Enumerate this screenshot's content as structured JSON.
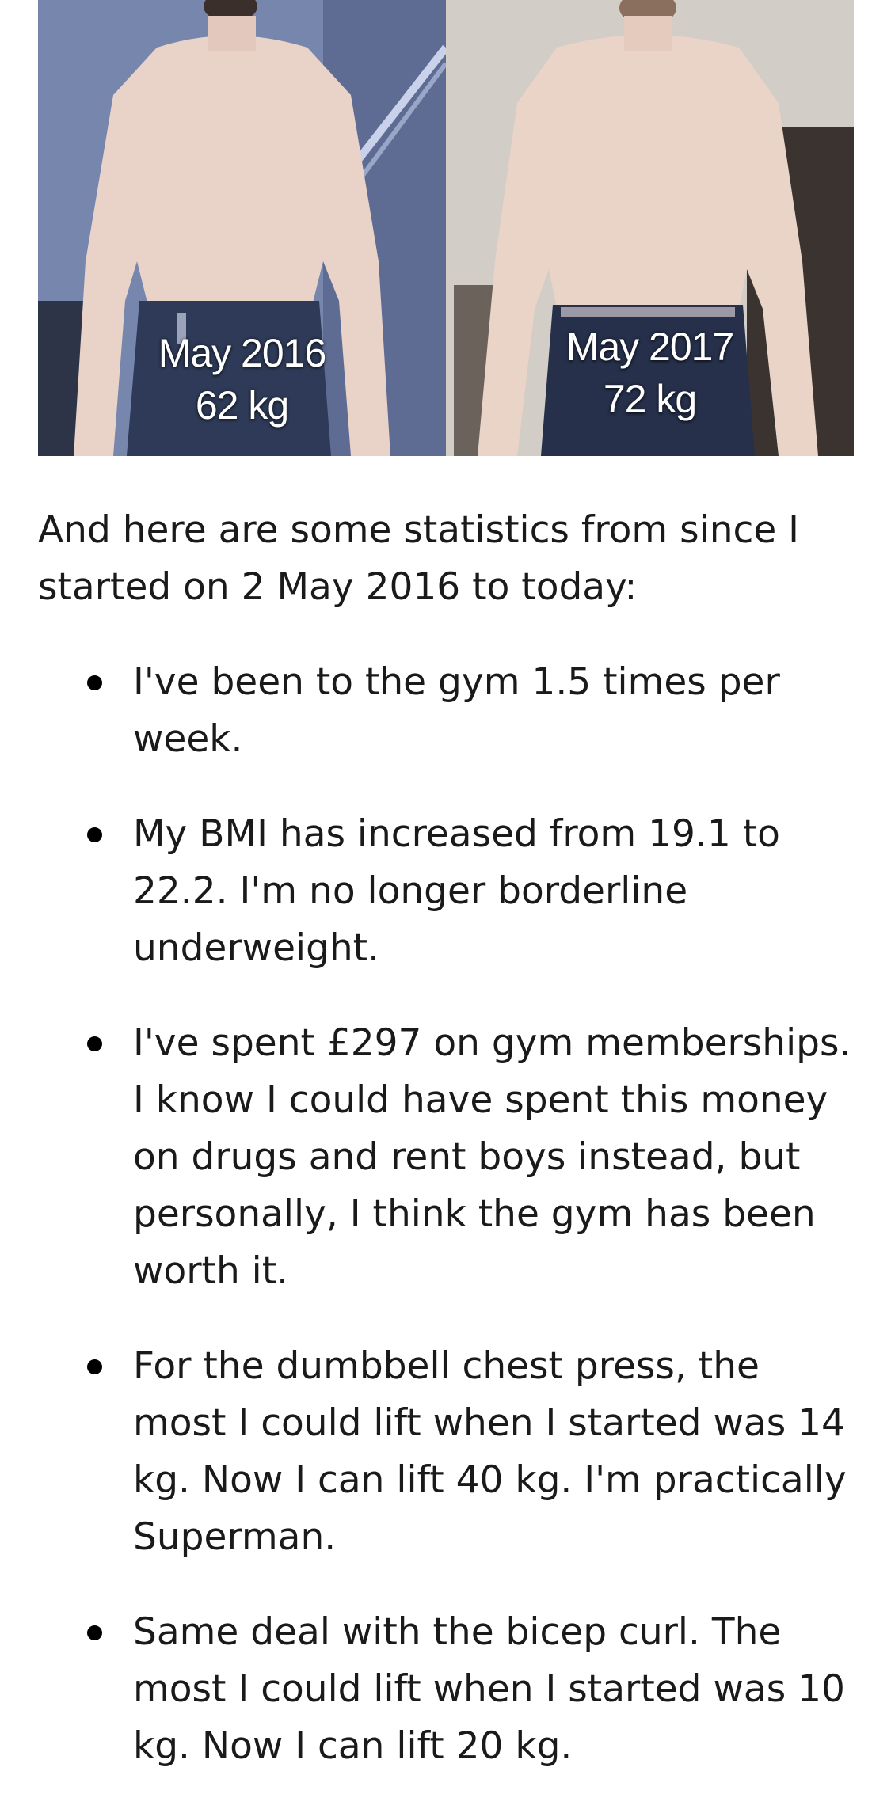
{
  "photo": {
    "before": {
      "label": "May 2016",
      "weight": "62 kg"
    },
    "after": {
      "label": "May 2017",
      "weight": "72 kg"
    }
  },
  "intro": "And here are some statistics from since I started on 2 May 2016 to today:",
  "stats": [
    "I've been to the gym 1.5 times per week.",
    "My BMI has increased from 19.1 to 22.2. I'm no longer borderline underweight.",
    "I've spent £297 on gym memberships. I know I could have spent this money on drugs and rent boys instead, but personally, I think the gym has been worth it.",
    "For the dumbbell chest press, the most I could lift when I started was 14 kg. Now I can lift 40 kg. I'm practically Superman.",
    "Same deal with the bicep curl. The most I could lift when I started was 10 kg. Now I can lift 20 kg."
  ]
}
